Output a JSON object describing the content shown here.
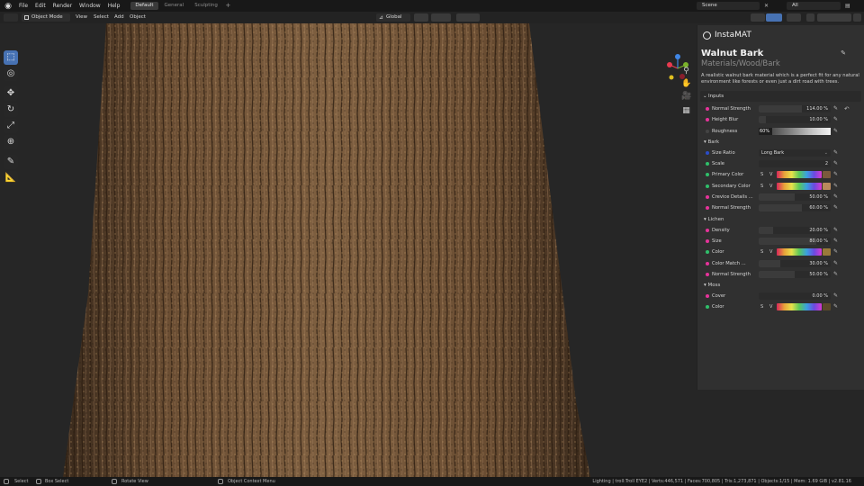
{
  "menu": {
    "items": [
      "File",
      "Edit",
      "Render",
      "Window",
      "Help"
    ]
  },
  "workspaces": {
    "tabs": [
      "Default",
      "General",
      "Sculpting"
    ]
  },
  "scene": {
    "name": "Scene",
    "view_layer": "All"
  },
  "header": {
    "mode": "Object Mode",
    "menus": [
      "View",
      "Select",
      "Add",
      "Object"
    ],
    "orientation": "Global"
  },
  "panel": {
    "brand": "InstaMAT",
    "title": "Walnut Bark",
    "path": "Materials/Wood/Bark",
    "description": "A realistic walnut bark material which is a perfect fit for any natural environment like forests or even just a dirt road with trees.",
    "inputs_label": "Inputs",
    "rows": [
      {
        "kind": "value",
        "label": "Normal Strength",
        "value": "114.00 %",
        "dot": "#e6339a",
        "fill": 0.6,
        "reset": true
      },
      {
        "kind": "value",
        "label": "Height Blur",
        "value": "10.00 %",
        "dot": "#e6339a",
        "fill": 0.1
      },
      {
        "kind": "rough",
        "label": "Roughness",
        "value": "60%",
        "dot": "#444444"
      },
      {
        "kind": "section",
        "label": "Bark"
      },
      {
        "kind": "enum",
        "label": "Size Ratio",
        "value": "Long Bark",
        "dot": "#2a4cc8"
      },
      {
        "kind": "value",
        "label": "Scale",
        "value": "2",
        "dot": "#2fbf6a",
        "fill": 0
      },
      {
        "kind": "color",
        "label": "Primary Color",
        "dot": "#2fbf6a",
        "swatch": "#7a5a3c"
      },
      {
        "kind": "color",
        "label": "Secondary Color",
        "dot": "#2fbf6a",
        "swatch": "#b98a5c"
      },
      {
        "kind": "value",
        "label": "Crevice Details ...",
        "value": "50.00 %",
        "dot": "#e6339a",
        "fill": 0.5
      },
      {
        "kind": "value",
        "label": "Normal Strength",
        "value": "60.00 %",
        "dot": "#e6339a",
        "fill": 0.6
      },
      {
        "kind": "section",
        "label": "Lichen"
      },
      {
        "kind": "value",
        "label": "Density",
        "value": "20.00 %",
        "dot": "#e6339a",
        "fill": 0.2
      },
      {
        "kind": "value",
        "label": "Size",
        "value": "80.00 %",
        "dot": "#e6339a",
        "fill": 0.8
      },
      {
        "kind": "color",
        "label": "Color",
        "dot": "#2fbf6a",
        "swatch": "#9a7a3a"
      },
      {
        "kind": "value",
        "label": "Color Match ...",
        "value": "30.00 %",
        "dot": "#e6339a",
        "fill": 0.3
      },
      {
        "kind": "value",
        "label": "Normal Strength",
        "value": "50.00 %",
        "dot": "#e6339a",
        "fill": 0.5
      },
      {
        "kind": "section",
        "label": "Moss"
      },
      {
        "kind": "value",
        "label": "Cover",
        "value": "0.00 %",
        "dot": "#e6339a",
        "fill": 0
      },
      {
        "kind": "color",
        "label": "Color",
        "dot": "#2fbf6a",
        "swatch": "#5a4a2a"
      }
    ],
    "s_label": "S",
    "v_label": "V"
  },
  "status": {
    "select": "Select",
    "box_select": "Box Select",
    "rotate_view": "Rotate View",
    "context_menu": "Object Context Menu",
    "stats": "Lighting | troll:Troll EYE2 | Verts:446,571 | Faces:700,805 | Tris:1,273,871 | Objects:1/15 | Mem: 1.69 GiB | v2.81.16"
  },
  "colors": {
    "accent": "#4772b3",
    "panel": "#303030",
    "bark": "#6b4e33"
  }
}
